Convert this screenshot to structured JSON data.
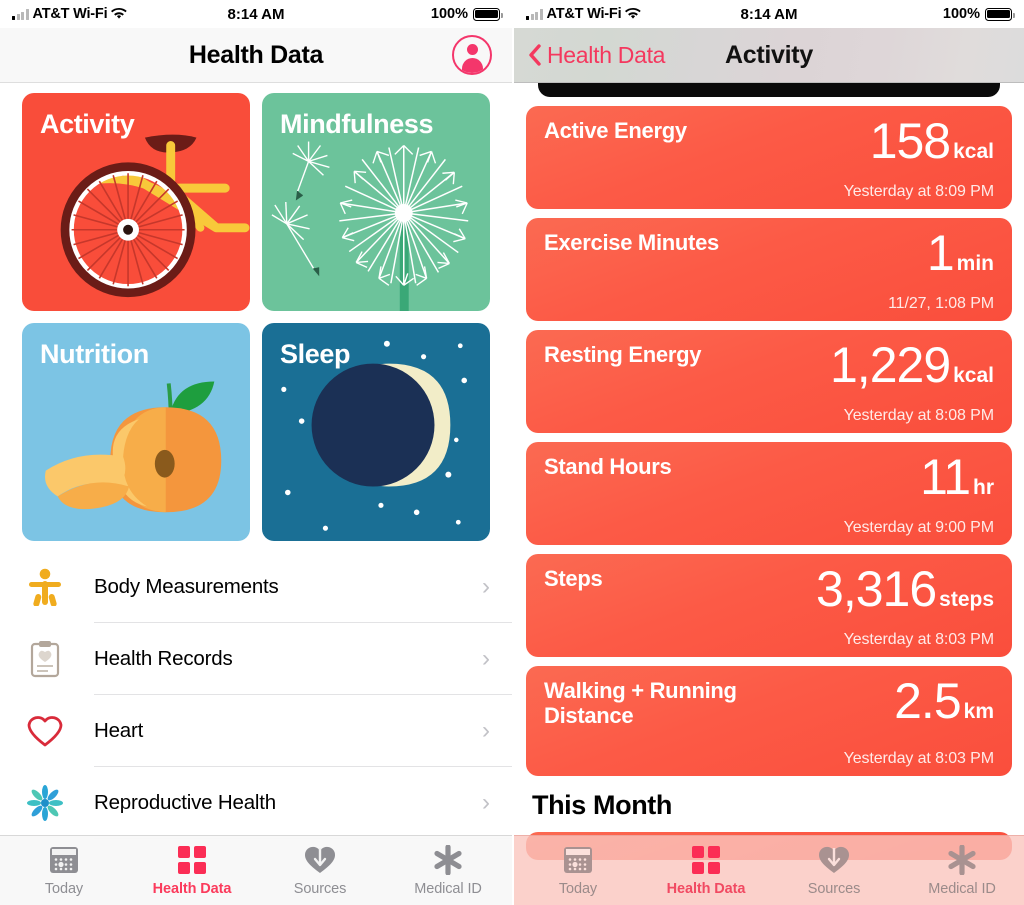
{
  "status_bar": {
    "carrier": "AT&T Wi-Fi",
    "time": "8:14 AM",
    "battery_percent": "100%",
    "signal_icon": "signal-bars-icon",
    "wifi_icon": "wifi-icon",
    "battery_icon": "battery-full-icon"
  },
  "left_screen": {
    "nav": {
      "title": "Health Data",
      "profile_icon": "profile-avatar-icon"
    },
    "tiles": [
      {
        "label": "Activity",
        "bg": "#f94d3a",
        "art": "bicycle-illustration"
      },
      {
        "label": "Mindfulness",
        "bg": "#6cc39b",
        "art": "dandelion-illustration"
      },
      {
        "label": "Nutrition",
        "bg": "#7cc4e4",
        "art": "peach-illustration"
      },
      {
        "label": "Sleep",
        "bg": "#1a6f95",
        "art": "crescent-moon-illustration"
      }
    ],
    "list": [
      {
        "label": "Body Measurements",
        "icon": "body-figure-icon",
        "color": "#f0ac1e"
      },
      {
        "label": "Health Records",
        "icon": "clipboard-icon",
        "color": "#b3a79b"
      },
      {
        "label": "Heart",
        "icon": "heart-outline-icon",
        "color": "#d92b3a"
      },
      {
        "label": "Reproductive Health",
        "icon": "flower-burst-icon",
        "color": "#2aa5d6"
      }
    ],
    "chevron": "›"
  },
  "right_screen": {
    "nav": {
      "back_label": "Health Data",
      "back_icon": "chevron-left-icon",
      "title": "Activity"
    },
    "cards": [
      {
        "name": "Active Energy",
        "value": "158",
        "unit": "kcal",
        "timestamp": "Yesterday at 8:09 PM"
      },
      {
        "name": "Exercise Minutes",
        "value": "1",
        "unit": "min",
        "timestamp": "11/27, 1:08 PM"
      },
      {
        "name": "Resting Energy",
        "value": "1,229",
        "unit": "kcal",
        "timestamp": "Yesterday at 8:08 PM"
      },
      {
        "name": "Stand Hours",
        "value": "11",
        "unit": "hr",
        "timestamp": "Yesterday at 9:00 PM"
      },
      {
        "name": "Steps",
        "value": "3,316",
        "unit": "steps",
        "timestamp": "Yesterday at 8:03 PM"
      },
      {
        "name": "Walking + Running Distance",
        "value": "2.5",
        "unit": "km",
        "timestamp": "Yesterday at 8:03 PM"
      }
    ],
    "section_title": "This Month"
  },
  "tab_bar": {
    "items": [
      {
        "label": "Today",
        "icon": "calendar-icon",
        "active": false
      },
      {
        "label": "Health Data",
        "icon": "four-squares-icon",
        "active": true
      },
      {
        "label": "Sources",
        "icon": "heart-download-icon",
        "active": false
      },
      {
        "label": "Medical ID",
        "icon": "medical-asterisk-icon",
        "active": false
      }
    ]
  },
  "colors": {
    "accent_pink": "#fb2d55",
    "card_red": "#fc5a46",
    "inactive_gray": "#8e8e93"
  }
}
